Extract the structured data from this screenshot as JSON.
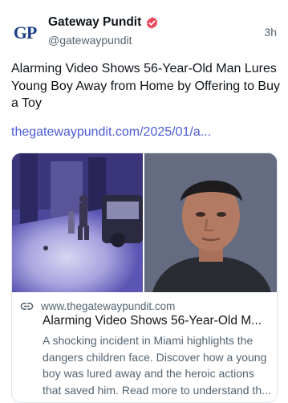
{
  "author": {
    "avatar_text": "GP",
    "name": "Gateway Pundit",
    "handle": "@gatewaypundit",
    "verified_icon": "verified-badge-icon"
  },
  "post": {
    "timestamp": "3h",
    "text": "Alarming Video Shows 56-Year-Old Man Lures Young Boy Away from Home by Offering to Buy a Toy",
    "link": "thegatewaypundit.com/2025/01/a..."
  },
  "card": {
    "link_icon": "link-icon",
    "domain": "www.thegatewaypundit.com",
    "title": "Alarming Video Shows 56-Year-Old M...",
    "description": "A shocking incident in Miami highlights the dangers children face. Discover how a young boy was lured away and the heroic actions that saved him. Read more to understand th..."
  },
  "colors": {
    "link": "#4b5bd4",
    "verified_badge": "#e8485c",
    "avatar_text": "#1f3f86",
    "secondary_text": "#536471"
  }
}
